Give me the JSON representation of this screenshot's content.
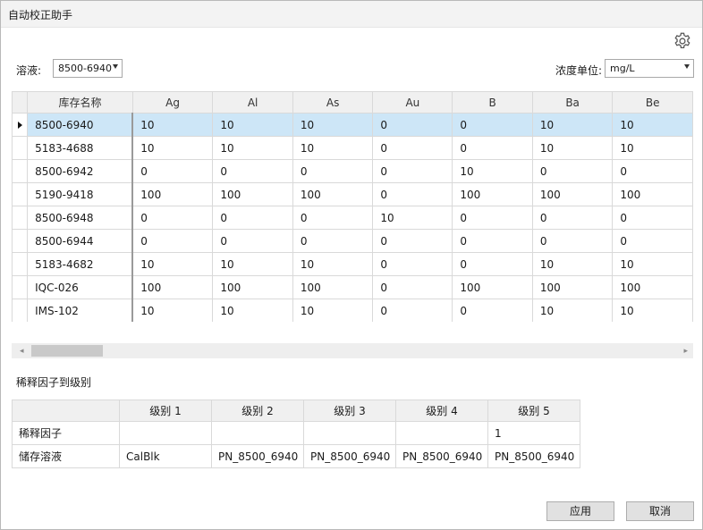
{
  "window": {
    "title": "自动校正助手"
  },
  "solution": {
    "label": "溶液:",
    "value": "8500-6940"
  },
  "unit": {
    "label": "浓度单位:",
    "value": "mg/L"
  },
  "grid": {
    "columns": [
      "库存名称",
      "Ag",
      "Al",
      "As",
      "Au",
      "B",
      "Ba",
      "Be"
    ],
    "rows": [
      {
        "name": "8500-6940",
        "values": [
          "10",
          "10",
          "10",
          "0",
          "0",
          "10",
          "10"
        ]
      },
      {
        "name": "5183-4688",
        "values": [
          "10",
          "10",
          "10",
          "0",
          "0",
          "10",
          "10"
        ]
      },
      {
        "name": "8500-6942",
        "values": [
          "0",
          "0",
          "0",
          "0",
          "10",
          "0",
          "0"
        ]
      },
      {
        "name": "5190-9418",
        "values": [
          "100",
          "100",
          "100",
          "0",
          "100",
          "100",
          "100"
        ]
      },
      {
        "name": "8500-6948",
        "values": [
          "0",
          "0",
          "0",
          "10",
          "0",
          "0",
          "0"
        ]
      },
      {
        "name": "8500-6944",
        "values": [
          "0",
          "0",
          "0",
          "0",
          "0",
          "0",
          "0"
        ]
      },
      {
        "name": "5183-4682",
        "values": [
          "10",
          "10",
          "10",
          "0",
          "0",
          "10",
          "10"
        ]
      },
      {
        "name": "IQC-026",
        "values": [
          "100",
          "100",
          "100",
          "0",
          "100",
          "100",
          "100"
        ]
      },
      {
        "name": "IMS-102",
        "values": [
          "10",
          "10",
          "10",
          "0",
          "0",
          "10",
          "10"
        ]
      }
    ],
    "selected_row": 0
  },
  "dilution": {
    "title": "稀释因子到级别",
    "columns": [
      "",
      "级别 1",
      "级别 2",
      "级别 3",
      "级别 4",
      "级别 5"
    ],
    "rows": [
      {
        "label": "稀释因子",
        "values": [
          "",
          "",
          "",
          "",
          "1"
        ]
      },
      {
        "label": "储存溶液",
        "values": [
          "CalBlk",
          "PN_8500_6940",
          "PN_8500_6940",
          "PN_8500_6940",
          "PN_8500_6940"
        ]
      }
    ]
  },
  "buttons": {
    "apply": "应用",
    "cancel": "取消"
  },
  "icons": {
    "settings": "gear-icon",
    "dropdown": "chevron-down-icon",
    "row_indicator": "caret-right-icon"
  },
  "colors": {
    "selected_row": "#cde6f7",
    "header_bg": "#f0f0f0",
    "button_bg": "#e1e1e1"
  }
}
